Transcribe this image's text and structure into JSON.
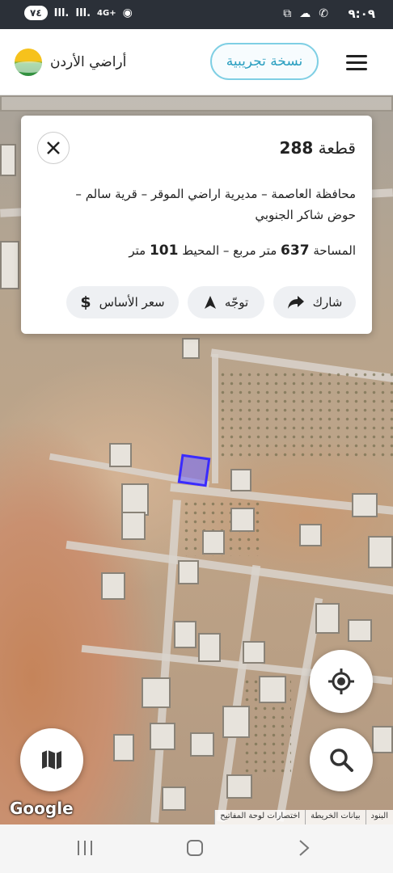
{
  "status_bar": {
    "time": "٩:٠٩",
    "battery": "٧٤",
    "network": "4G+",
    "signal_1": "Ill.",
    "signal_2": "Ill."
  },
  "header": {
    "brand_name": "أراضي الأردن",
    "trial_button": "نسخة تجريبية"
  },
  "parcel_card": {
    "title_prefix": "قطعة",
    "parcel_number": "288",
    "address": "محافظة العاصمة – مديرية اراضي الموقر – قرية سالم – حوض شاكر الجنوبي",
    "area_label": "المساحة",
    "area_value": "637",
    "area_unit": "متر مربع",
    "separator": "–",
    "perimeter_label": "المحيط",
    "perimeter_value": "101",
    "perimeter_unit": "متر",
    "actions": {
      "share": "شارك",
      "navigate": "توجّه",
      "base_price": "سعر الأساس"
    }
  },
  "map": {
    "google_logo": "Google",
    "attribution": {
      "terms": "البنود",
      "map_data": "بيانات الخريطة",
      "keyboard_shortcuts": "اختصارات لوحة المفاتيح"
    }
  },
  "colors": {
    "accent": "#2a9fc0",
    "parcel_fill": "#6e64ff",
    "parcel_stroke": "#3a2bff"
  }
}
